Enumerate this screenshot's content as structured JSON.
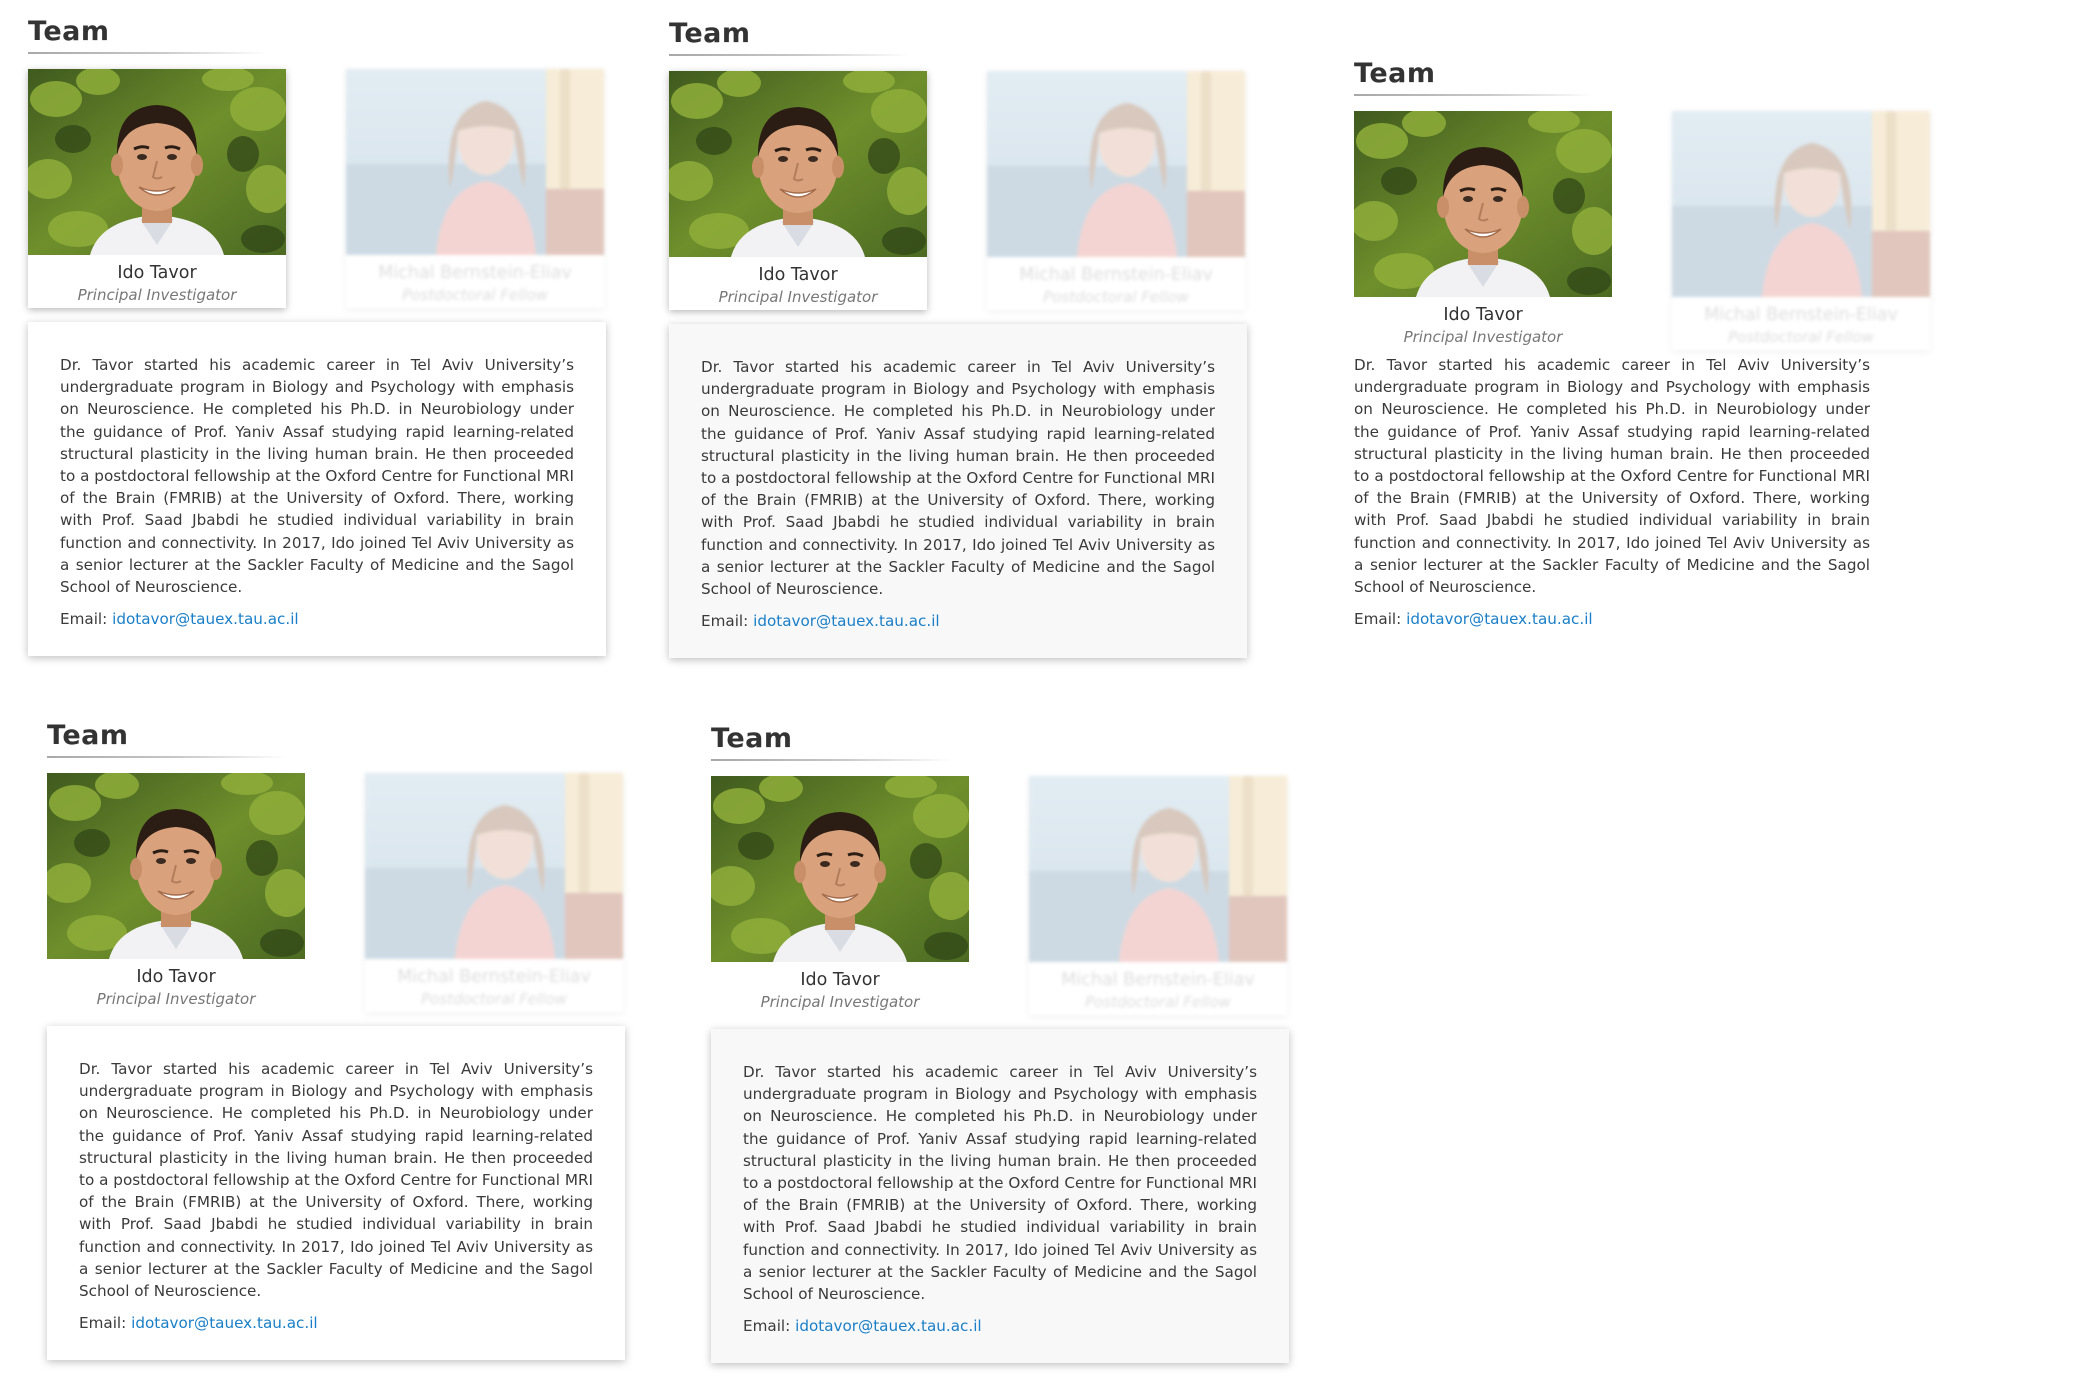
{
  "section": {
    "title": "Team"
  },
  "members": [
    {
      "name": "Ido Tavor",
      "role": "Principal Investigator",
      "photo_icon": "portrait-man-photo"
    },
    {
      "name": "Michal Bernstein-Eliav",
      "role": "Postdoctoral Fellow",
      "photo_icon": "portrait-woman-photo"
    }
  ],
  "bio": {
    "text": "Dr. Tavor started his academic career in Tel Aviv University’s undergraduate program in Biology and Psychology with emphasis on Neuroscience. He completed his Ph.D. in Neurobiology under the guidance of Prof. Yaniv Assaf studying rapid learning-related structural plasticity in the living human brain. He then proceeded to a postdoctoral fellowship at the Oxford Centre for Functional MRI of the Brain (FMRIB) at the University of Oxford. There, working with Prof. Saad Jbabdi he studied individual variability in brain function and connectivity. In 2017, Ido joined Tel Aviv University as a senior lecturer at the Sackler Faculty of Medicine and the Sagol School of Neuroscience.",
    "email_label": "Email:",
    "email": "idotavor@tauex.tau.ac.il"
  },
  "colors": {
    "link": "#1a7fc8",
    "title": "#333333",
    "role_text": "#777777",
    "grey_card": "#f8f8f8"
  }
}
